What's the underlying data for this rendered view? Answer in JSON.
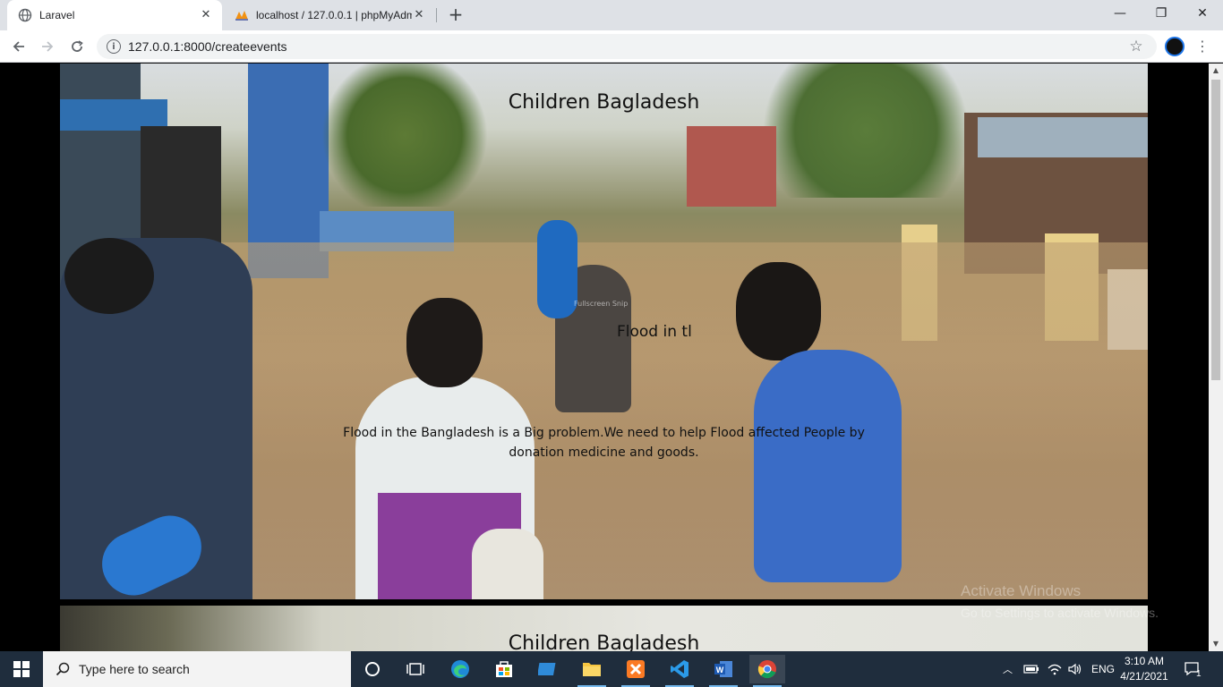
{
  "browser": {
    "tabs": [
      {
        "title": "Laravel",
        "active": true
      },
      {
        "title": "localhost / 127.0.0.1 | phpMyAdm",
        "active": false
      }
    ],
    "url": "127.0.0.1:8000/createevents",
    "window_controls": {
      "minimize": "—",
      "restore": "❐",
      "close": "✕"
    }
  },
  "page": {
    "events": [
      {
        "title": "Children Bagladesh",
        "subtitle": "Flood in tl",
        "description": "Flood in the Bangladesh is a Big problem.We need to help Flood affected People by donation medicine and goods."
      },
      {
        "title": "Children Bagladesh"
      }
    ],
    "overlay_snip": "Fullscreen Snip"
  },
  "windows_watermark": {
    "line1": "Activate Windows",
    "line2": "Go to Settings to activate Windows."
  },
  "taskbar": {
    "search_placeholder": "Type here to search",
    "language": "ENG",
    "time": "3:10 AM",
    "date": "4/21/2021",
    "notification_count": "1"
  },
  "colors": {
    "taskbar_bg": "#1f2d3d",
    "tabstrip_bg": "#dee1e6",
    "omnibox_bg": "#f1f3f4"
  }
}
